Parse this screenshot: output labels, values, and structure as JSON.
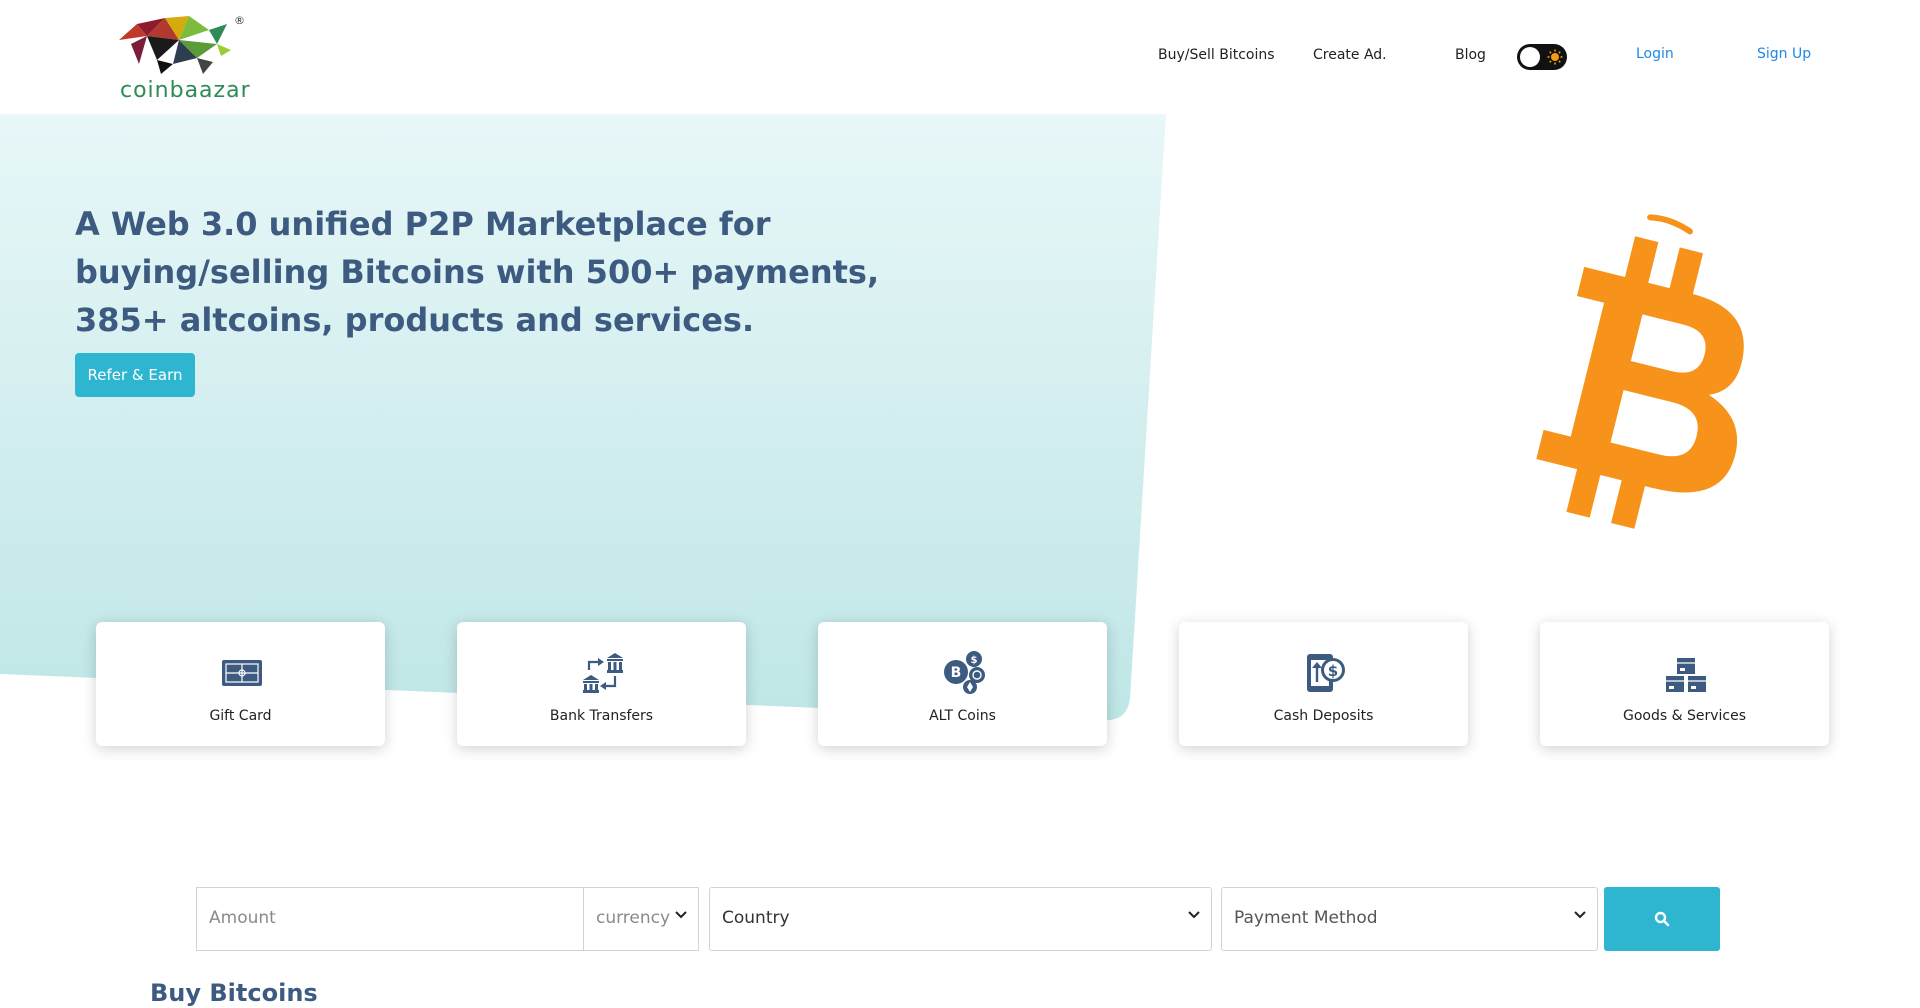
{
  "brand": {
    "name": "coinbaazar",
    "registered_mark": "®"
  },
  "nav": {
    "items": [
      "Buy/Sell Bitcoins",
      "Create Ad.",
      "Blog"
    ],
    "login": "Login",
    "signup": "Sign Up",
    "theme_toggle_icon": "sun-icon"
  },
  "hero": {
    "title": "A Web 3.0 unified P2P Marketplace for buying/selling Bitcoins with 500+ payments, 385+ altcoins, products and services.",
    "cta": "Refer & Earn",
    "illustration": "bitcoin-logo"
  },
  "categories": [
    {
      "label": "Gift Card",
      "icon": "gift-card-icon"
    },
    {
      "label": "Bank Transfers",
      "icon": "bank-transfer-icon"
    },
    {
      "label": "ALT Coins",
      "icon": "alt-coins-icon"
    },
    {
      "label": "Cash Deposits",
      "icon": "cash-deposit-icon"
    },
    {
      "label": "Goods & Services",
      "icon": "goods-services-icon"
    }
  ],
  "search": {
    "amount_placeholder": "Amount",
    "currency": "currency",
    "country": "Country",
    "payment_method": "Payment Method",
    "button_icon": "search-icon"
  },
  "section": {
    "heading": "Buy Bitcoins"
  },
  "colors": {
    "primary": "#2eb5cf",
    "heading": "#3d5a80",
    "bitcoin": "#f7931a",
    "hero_bg": "#cdeeee"
  }
}
